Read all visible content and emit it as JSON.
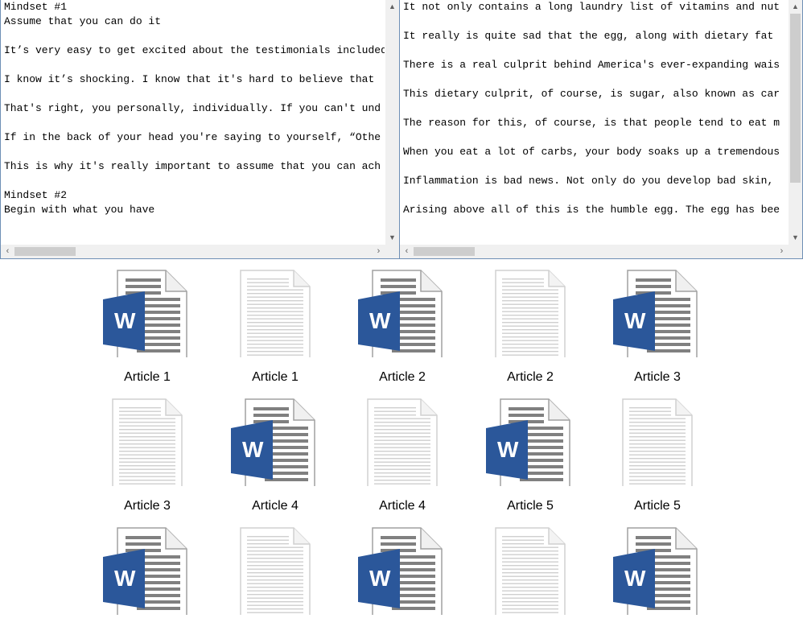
{
  "left_notepad": {
    "lines": [
      "Mindset #1",
      "Assume that you can do it",
      "",
      "It’s very easy to get excited about the testimonials included",
      "",
      "I know it’s shocking. I know that it's hard to believe that",
      "",
      "That's right, you personally, individually. If you can't und",
      "",
      "If in the back of your head you're saying to yourself, “Othe",
      "",
      "This is why it's really important to assume that you can ach",
      "",
      "Mindset #2",
      "Begin with what you have"
    ]
  },
  "right_notepad": {
    "lines": [
      "It not only contains a long laundry list of vitamins and nut",
      "",
      "It really is quite sad that the egg, along with dietary fat",
      "",
      "There is a real culprit behind America's ever-expanding wais",
      "",
      "This dietary culprit, of course, is sugar, also known as car",
      "",
      "The reason for this, of course, is that people tend to eat m",
      "",
      "When you eat a lot of carbs, your body soaks up a tremendous",
      "",
      "Inflammation is bad news. Not only do you develop bad skin,",
      "",
      "Arising above all of this is the humble egg. The egg has bee"
    ]
  },
  "files": [
    {
      "name": "Article 1",
      "type": "word"
    },
    {
      "name": "Article 1",
      "type": "text"
    },
    {
      "name": "Article 2",
      "type": "word"
    },
    {
      "name": "Article 2",
      "type": "text"
    },
    {
      "name": "Article 3",
      "type": "word"
    },
    {
      "name": "Article 3",
      "type": "text"
    },
    {
      "name": "Article 4",
      "type": "word"
    },
    {
      "name": "Article 4",
      "type": "text"
    },
    {
      "name": "Article 5",
      "type": "word"
    },
    {
      "name": "Article 5",
      "type": "text"
    },
    {
      "name": "",
      "type": "word"
    },
    {
      "name": "",
      "type": "text"
    },
    {
      "name": "",
      "type": "word"
    },
    {
      "name": "",
      "type": "text"
    },
    {
      "name": "",
      "type": "word"
    }
  ],
  "icons": {
    "scroll_up": "▲",
    "scroll_down": "▼",
    "scroll_left": "‹",
    "scroll_right": "›",
    "word_badge": "W"
  },
  "colors": {
    "word_blue": "#2b579a",
    "window_border": "#6e8fb5"
  }
}
